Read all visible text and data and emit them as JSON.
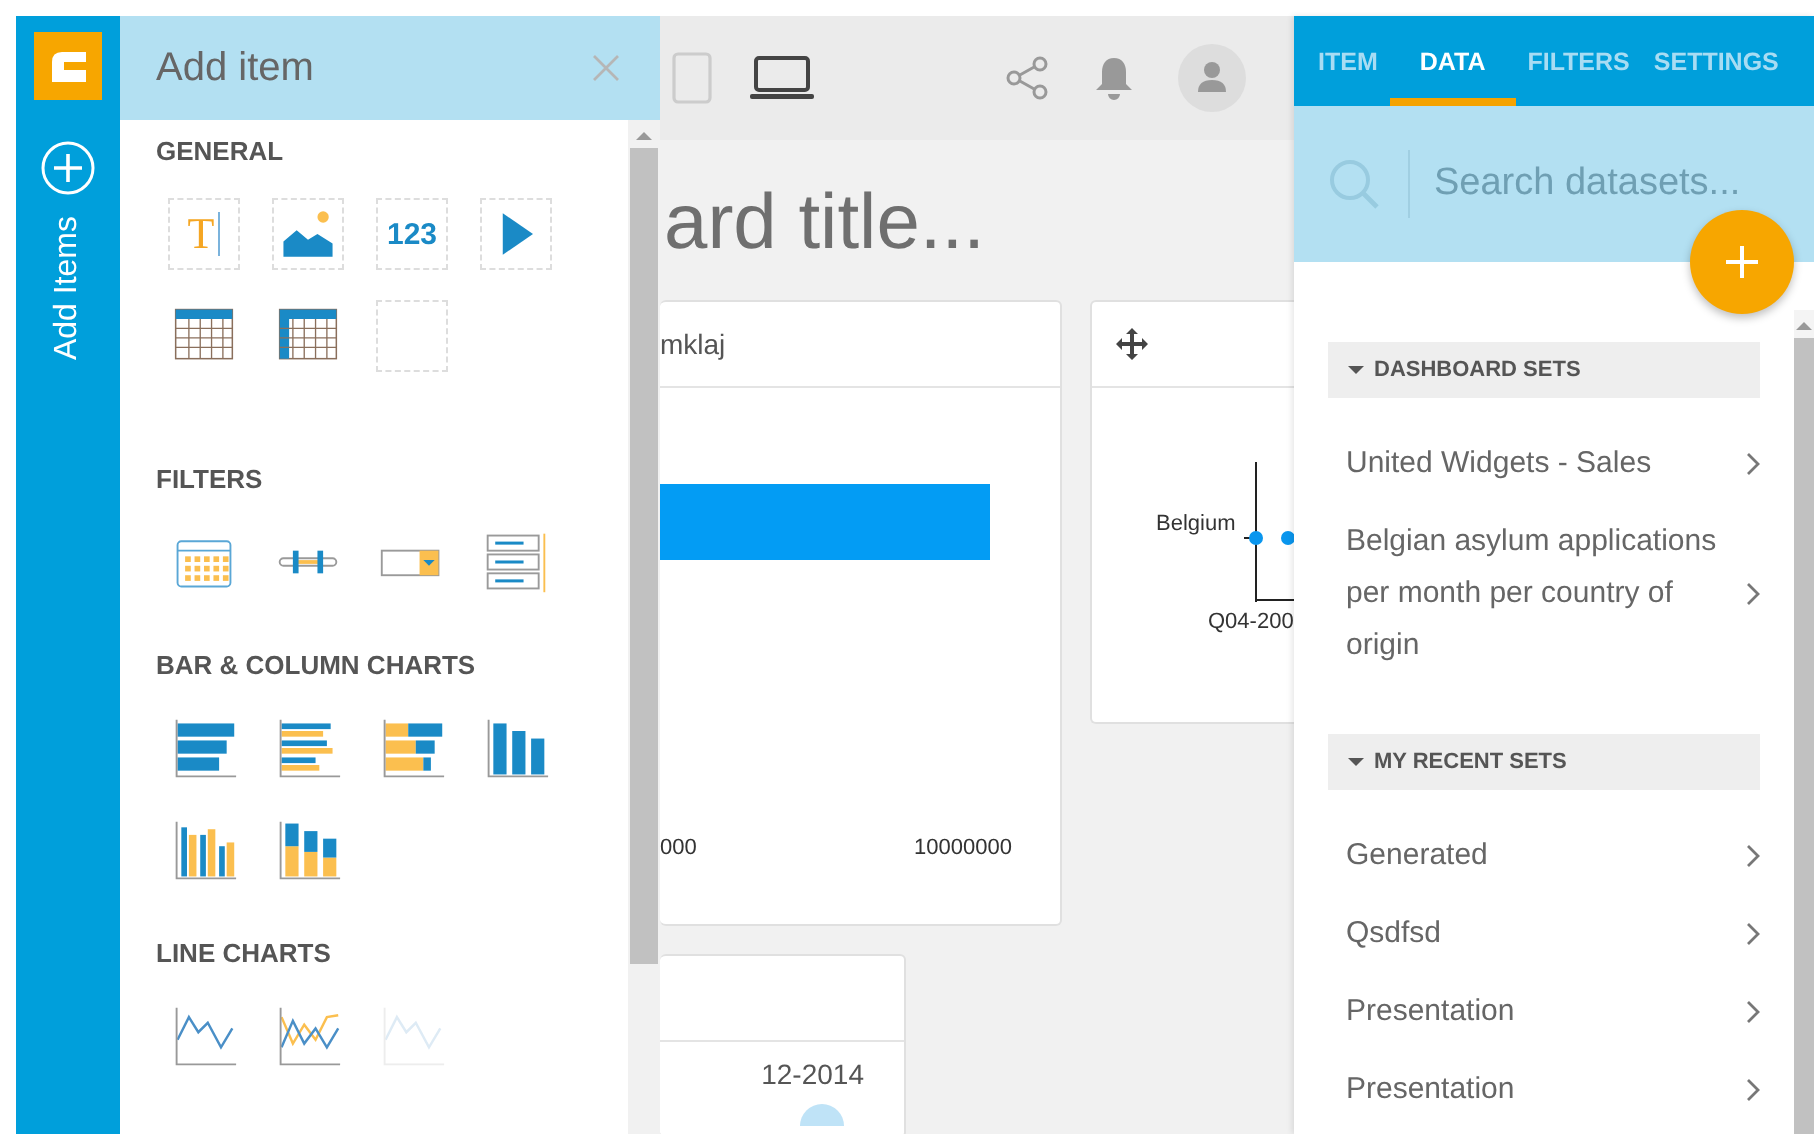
{
  "rail": {
    "label": "Add Items"
  },
  "add_panel": {
    "title": "Add item",
    "sections": [
      {
        "heading": "GENERAL",
        "items": [
          {
            "kind": "text",
            "glyph": "T"
          },
          {
            "kind": "image"
          },
          {
            "kind": "number",
            "glyph": "123"
          },
          {
            "kind": "video"
          },
          {
            "kind": "table"
          },
          {
            "kind": "pivot"
          },
          {
            "kind": "blank"
          }
        ]
      },
      {
        "heading": "FILTERS",
        "items": [
          {
            "kind": "date"
          },
          {
            "kind": "slider"
          },
          {
            "kind": "dropdown"
          },
          {
            "kind": "list"
          }
        ]
      },
      {
        "heading": "BAR & COLUMN CHARTS",
        "items": [
          {
            "kind": "hbar"
          },
          {
            "kind": "hbar-grouped"
          },
          {
            "kind": "hbar-stacked"
          },
          {
            "kind": "column"
          },
          {
            "kind": "column-grouped"
          },
          {
            "kind": "column-stacked"
          }
        ]
      },
      {
        "heading": "LINE CHARTS",
        "items": [
          {
            "kind": "line",
            "disabled": false
          },
          {
            "kind": "multiline",
            "disabled": false
          },
          {
            "kind": "line",
            "disabled": true
          }
        ]
      }
    ]
  },
  "toolbar": {
    "devices": [
      {
        "kind": "tablet",
        "selected": false
      },
      {
        "kind": "laptop",
        "selected": true
      }
    ]
  },
  "dashboard": {
    "title": "ard title...",
    "widgets": [
      {
        "kind": "bar",
        "title": "mklaj",
        "ticks": [
          "000",
          "10000000"
        ]
      },
      {
        "kind": "scatter",
        "category": "Belgium",
        "xtick": "Q04-200"
      },
      {
        "kind": "table",
        "cell": "12-2014"
      }
    ]
  },
  "data_panel": {
    "tabs": [
      {
        "label": "ITEM",
        "selected": false
      },
      {
        "label": "DATA",
        "selected": true
      },
      {
        "label": "FILTERS",
        "selected": false
      },
      {
        "label": "SETTINGS",
        "selected": false
      }
    ],
    "search": {
      "placeholder": "Search datasets..."
    },
    "sections": [
      {
        "title": "DASHBOARD SETS",
        "expanded": true,
        "items": [
          "United Widgets - Sales",
          "Belgian asylum applications per month per country of origin"
        ]
      },
      {
        "title": "MY RECENT SETS",
        "expanded": true,
        "items": [
          "Generated",
          "Qsdfsd",
          "Presentation",
          "Presentation"
        ]
      }
    ]
  }
}
